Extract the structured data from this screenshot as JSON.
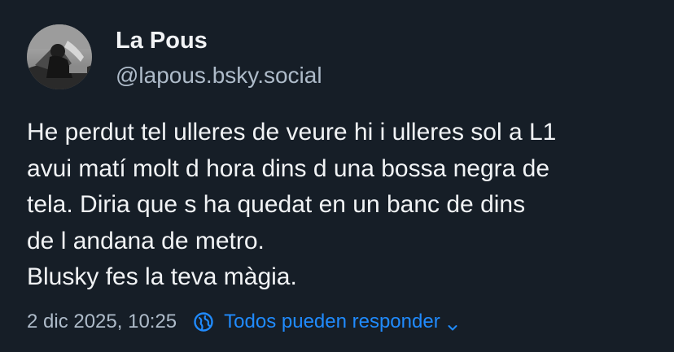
{
  "author": {
    "display_name": "La Pous",
    "handle": "@lapous.bsky.social",
    "avatar_icon": "avatar-photo"
  },
  "post": {
    "lines": [
      "He perdut tel ulleres de veure hi i ulleres sol a L1",
      "avui matí molt d hora dins d una bossa negra de",
      "tela. Diria que s ha quedat en un banc de dins",
      "de l andana de metro.",
      "Blusky fes la teva màgia."
    ]
  },
  "meta": {
    "timestamp": "2 dic 2025, 10:25",
    "reply_settings_label": "Todos pueden responder",
    "reply_icon": "globe-icon",
    "dropdown_icon": "chevron-down-icon"
  },
  "colors": {
    "background": "#161e27",
    "text_primary": "#f1f3f5",
    "text_secondary": "#aebbc9",
    "accent": "#208bfe"
  }
}
